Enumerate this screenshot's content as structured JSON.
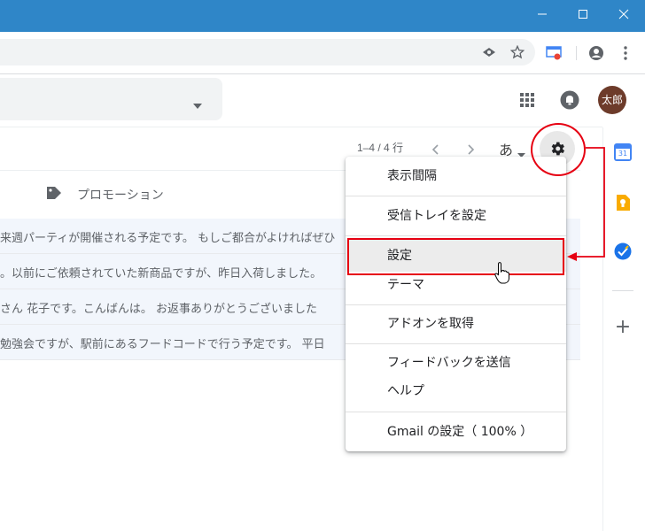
{
  "window": {
    "minimize_glyph": "—",
    "maximize_glyph": "☐",
    "close_glyph": "✕"
  },
  "toolbar": {
    "icons": [
      "eye-icon",
      "star-icon",
      "cast-icon",
      "profile-icon",
      "more-vert-icon"
    ]
  },
  "header": {
    "avatar_text": "太郎",
    "icons": [
      "apps-grid-icon",
      "notifications-icon"
    ]
  },
  "action_bar": {
    "pager_text": "1–4 / 4 行",
    "input_tool_label": "あ"
  },
  "tabs": {
    "promotions_label": "プロモーション"
  },
  "emails": [
    {
      "snippet": "来週パーティが開催される予定です。 もしご都合がよければぜひ"
    },
    {
      "snippet": "。以前にご依頼されていた新商品ですが、昨日入荷しました。"
    },
    {
      "snippet": "さん 花子です。こんばんは。 お返事ありがとうございました"
    },
    {
      "snippet": "勉強会ですが、駅前にあるフードコードで行う予定です。 平日"
    }
  ],
  "menu": {
    "items": [
      {
        "label": "表示間隔"
      },
      {
        "label": "受信トレイを設定"
      },
      {
        "label": "設定"
      },
      {
        "label": "テーマ"
      },
      {
        "label": "アドオンを取得"
      },
      {
        "label": "フィードバックを送信"
      },
      {
        "label": "ヘルプ"
      },
      {
        "label": "Gmail の設定（ 100% ）"
      }
    ]
  },
  "side_panel": {
    "calendar_day": "31",
    "add_glyph": "+"
  },
  "colors": {
    "annotation_red": "#e60012",
    "title_bar": "#2f86c8"
  }
}
